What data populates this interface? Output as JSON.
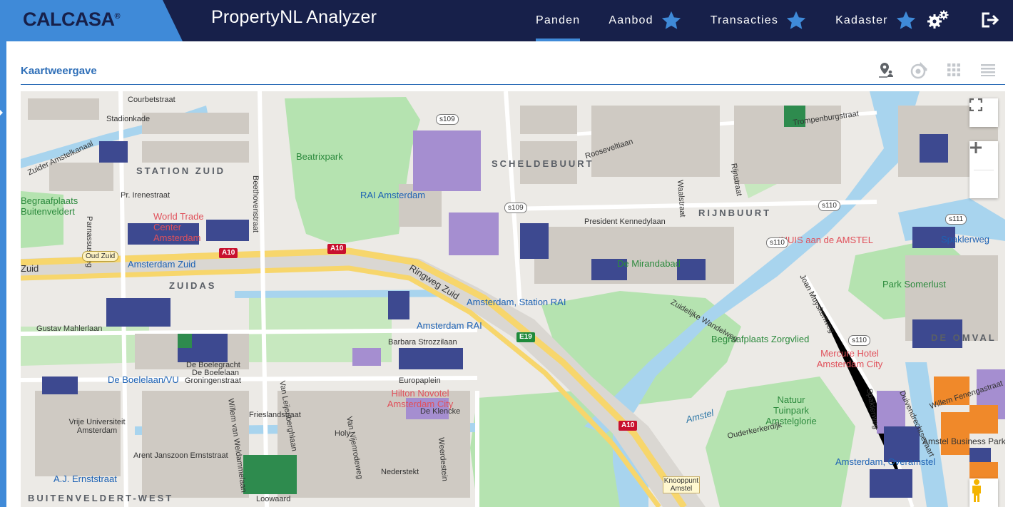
{
  "brand": {
    "logo": "CALCASA",
    "reg": "®",
    "app_title": "PropertyNL Analyzer"
  },
  "nav": {
    "items": [
      {
        "label": "Panden",
        "active": true,
        "star": false
      },
      {
        "label": "Aanbod",
        "active": false,
        "star": true
      },
      {
        "label": "Transacties",
        "active": false,
        "star": true
      },
      {
        "label": "Kadaster",
        "active": false,
        "star": true
      }
    ],
    "icons": [
      "gears-icon",
      "logout-icon"
    ]
  },
  "panel": {
    "title": "Kaartweergave",
    "tools": [
      "map-marker-user-icon",
      "map-layers-icon",
      "grid-view-icon",
      "list-view-icon"
    ]
  },
  "map": {
    "districts": [
      "STATION ZUID",
      "SCHELDEBUURT",
      "RIJNBUURT",
      "ZUIDAS",
      "DE OMVAL",
      "BUITENVELDERT-WEST"
    ],
    "parks": [
      "Beatrixpark",
      "Park Somerlust",
      "Begraafplaats Zorgvlied",
      "Natuur Tuinpark Amstelglorie",
      "Begraafplaats Buitenveldert",
      "De Mirandabad"
    ],
    "pois": [
      "World Trade Center Amsterdam",
      "RAI Amsterdam",
      "tHUIS aan de AMSTEL",
      "Mercure Hotel Amsterdam City",
      "Hilton Novotel Amsterdam City"
    ],
    "stations": [
      "Amsterdam Zuid",
      "Amsterdam, Station RAI",
      "Amsterdam RAI",
      "De Boelelaan/VU",
      "A.J. Ernststraat",
      "Amsterdam, Overamstel",
      "Spaklerweg"
    ],
    "streets": [
      "Parnassusweg",
      "Beethovenstraat",
      "Stadionkade",
      "Courbetstraat",
      "Zuider Amstelkanaal",
      "Pr. Irenestraat",
      "Oud Zuid",
      "Zuid",
      "Gustav Mahlerlaan",
      "De Boelegracht",
      "De Boelelaan",
      "Groningenstraat",
      "Van Leijenberghlaan",
      "Willem van Weldammelaan",
      "Frieslandstraat",
      "Arent Janszoon Ernststraat",
      "Loowaard",
      "Nederstekt",
      "Holy",
      "Van Nijenrodeweg",
      "De Klencke",
      "Weerdestein",
      "Ringweg Zuid",
      "Barbara Strozzilaan",
      "Rooseveltlaan",
      "President Kennedylaan",
      "Waalstraat",
      "Rijnstraat",
      "Zuidelijke Wandelweg",
      "Joan Muyskenweg",
      "Duivendrechtsevaart",
      "Willem Fenengastraat",
      "Spaklerweg",
      "Amstel Business Park",
      "Amstel",
      "Ouderkerkerdijk",
      "Knooppunt Amstel",
      "Vrije Universiteit Amsterdam",
      "Trompenburgstraat",
      "Europaplein"
    ],
    "road_shields": [
      "s109",
      "s109",
      "s110",
      "s110",
      "s110",
      "s111",
      "A10",
      "A10",
      "A10",
      "E19"
    ],
    "controls": {
      "fullscreen": "fullscreen-icon",
      "zoom_in": "+",
      "zoom_out": "−",
      "streetview": "pegman-icon"
    },
    "colors": {
      "land": "#eceae6",
      "park": "#b5e3b0",
      "water": "#a8d4ee",
      "highway": "#f7d66c",
      "building_navy": "#3d4990",
      "building_lilac": "#a58ed0",
      "building_orange": "#f0892a",
      "building_green": "#2e8b4e"
    }
  }
}
